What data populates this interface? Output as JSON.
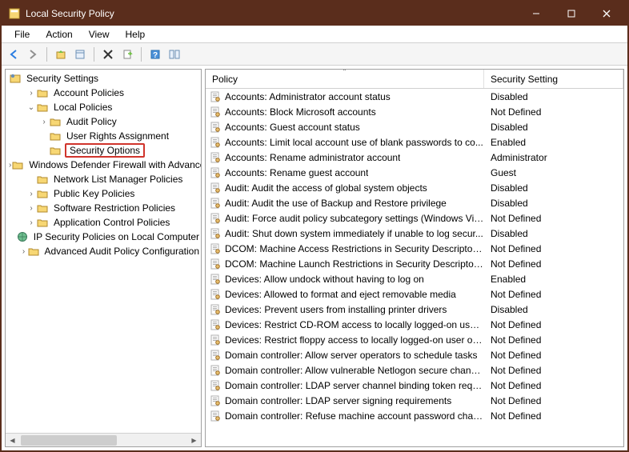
{
  "window": {
    "title": "Local Security Policy"
  },
  "menubar": [
    "File",
    "Action",
    "View",
    "Help"
  ],
  "toolbar_icons": [
    "back",
    "forward",
    "up",
    "properties",
    "delete",
    "export",
    "help",
    "show-hide"
  ],
  "tree": {
    "root_label": "Security Settings",
    "nodes": [
      {
        "label": "Account Policies",
        "depth": 1,
        "twisty": ">",
        "icon": "folder"
      },
      {
        "label": "Local Policies",
        "depth": 1,
        "twisty": "v",
        "icon": "folder"
      },
      {
        "label": "Audit Policy",
        "depth": 2,
        "twisty": ">",
        "icon": "folder"
      },
      {
        "label": "User Rights Assignment",
        "depth": 2,
        "twisty": "",
        "icon": "folder"
      },
      {
        "label": "Security Options",
        "depth": 2,
        "twisty": "",
        "icon": "folder",
        "highlight": true
      },
      {
        "label": "Windows Defender Firewall with Advanced Security",
        "depth": 1,
        "twisty": ">",
        "icon": "folder"
      },
      {
        "label": "Network List Manager Policies",
        "depth": 1,
        "twisty": "",
        "icon": "folder-net"
      },
      {
        "label": "Public Key Policies",
        "depth": 1,
        "twisty": ">",
        "icon": "folder"
      },
      {
        "label": "Software Restriction Policies",
        "depth": 1,
        "twisty": ">",
        "icon": "folder"
      },
      {
        "label": "Application Control Policies",
        "depth": 1,
        "twisty": ">",
        "icon": "folder"
      },
      {
        "label": "IP Security Policies on Local Computer",
        "depth": 1,
        "twisty": "",
        "icon": "ipsec"
      },
      {
        "label": "Advanced Audit Policy Configuration",
        "depth": 1,
        "twisty": ">",
        "icon": "folder"
      }
    ]
  },
  "list": {
    "columns": {
      "policy": "Policy",
      "setting": "Security Setting"
    },
    "rows": [
      {
        "policy": "Accounts: Administrator account status",
        "setting": "Disabled"
      },
      {
        "policy": "Accounts: Block Microsoft accounts",
        "setting": "Not Defined"
      },
      {
        "policy": "Accounts: Guest account status",
        "setting": "Disabled"
      },
      {
        "policy": "Accounts: Limit local account use of blank passwords to co...",
        "setting": "Enabled"
      },
      {
        "policy": "Accounts: Rename administrator account",
        "setting": "Administrator"
      },
      {
        "policy": "Accounts: Rename guest account",
        "setting": "Guest"
      },
      {
        "policy": "Audit: Audit the access of global system objects",
        "setting": "Disabled"
      },
      {
        "policy": "Audit: Audit the use of Backup and Restore privilege",
        "setting": "Disabled"
      },
      {
        "policy": "Audit: Force audit policy subcategory settings (Windows Vis...",
        "setting": "Not Defined"
      },
      {
        "policy": "Audit: Shut down system immediately if unable to log secur...",
        "setting": "Disabled"
      },
      {
        "policy": "DCOM: Machine Access Restrictions in Security Descriptor D...",
        "setting": "Not Defined"
      },
      {
        "policy": "DCOM: Machine Launch Restrictions in Security Descriptor ...",
        "setting": "Not Defined"
      },
      {
        "policy": "Devices: Allow undock without having to log on",
        "setting": "Enabled"
      },
      {
        "policy": "Devices: Allowed to format and eject removable media",
        "setting": "Not Defined"
      },
      {
        "policy": "Devices: Prevent users from installing printer drivers",
        "setting": "Disabled"
      },
      {
        "policy": "Devices: Restrict CD-ROM access to locally logged-on user ...",
        "setting": "Not Defined"
      },
      {
        "policy": "Devices: Restrict floppy access to locally logged-on user only",
        "setting": "Not Defined"
      },
      {
        "policy": "Domain controller: Allow server operators to schedule tasks",
        "setting": "Not Defined"
      },
      {
        "policy": "Domain controller: Allow vulnerable Netlogon secure chann...",
        "setting": "Not Defined"
      },
      {
        "policy": "Domain controller: LDAP server channel binding token requi...",
        "setting": "Not Defined"
      },
      {
        "policy": "Domain controller: LDAP server signing requirements",
        "setting": "Not Defined"
      },
      {
        "policy": "Domain controller: Refuse machine account password chan...",
        "setting": "Not Defined"
      }
    ]
  }
}
